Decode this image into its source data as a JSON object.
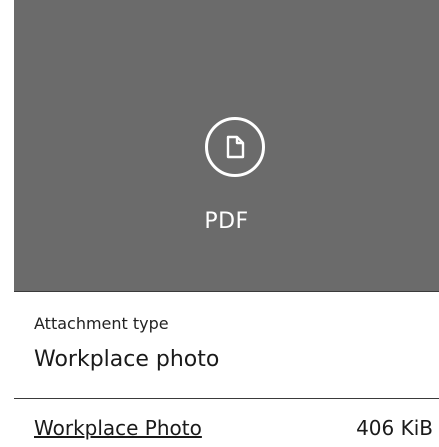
{
  "preview": {
    "type_label": "PDF",
    "icon": "document-icon",
    "background": "#6b6b6b"
  },
  "attachment": {
    "type_label": "Attachment type",
    "type_value": "Workplace photo"
  },
  "file": {
    "name": "Workplace Photo",
    "size": "406 KiB"
  }
}
